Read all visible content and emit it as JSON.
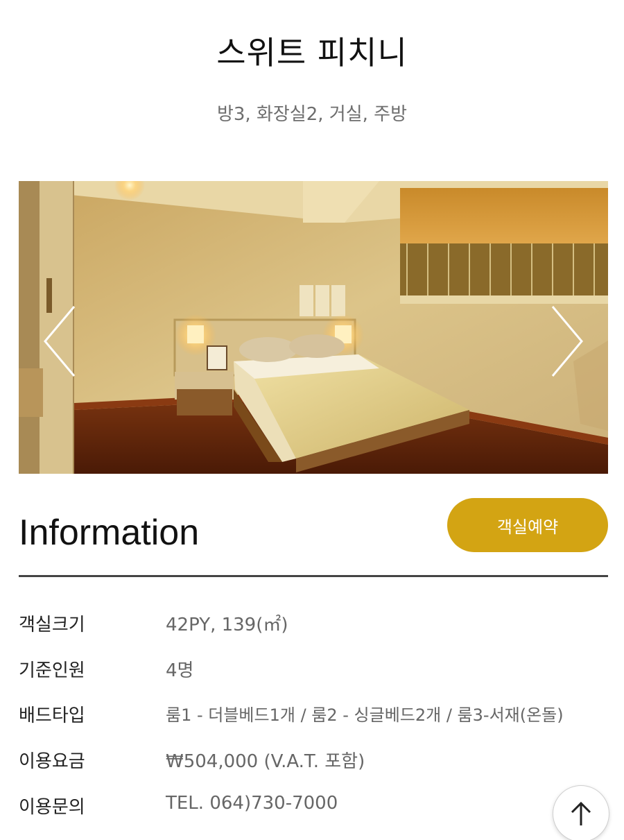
{
  "room": {
    "title": "스위트 피치니",
    "subtitle": "방3, 화장실2, 거실, 주방"
  },
  "gallery": {
    "prev_icon": "chevron-left-icon",
    "next_icon": "chevron-right-icon"
  },
  "information": {
    "heading": "Information",
    "reserve_label": "객실예약",
    "accent_color": "#d3a413",
    "rows": [
      {
        "label": "객실크기",
        "value": "42PY, 139(㎡)"
      },
      {
        "label": "기준인원",
        "value": "4명"
      },
      {
        "label": "배드타입",
        "value": "룸1 - 더블베드1개 / 룸2 - 싱글베드2개 / 룸3-서재(온돌)"
      },
      {
        "label": "이용요금",
        "value": "₩504,000 (V.A.T. 포함)"
      },
      {
        "label": "이용문의",
        "value": "TEL. 064)730-7000"
      }
    ]
  },
  "scroll_top": {
    "icon": "arrow-up-icon"
  }
}
